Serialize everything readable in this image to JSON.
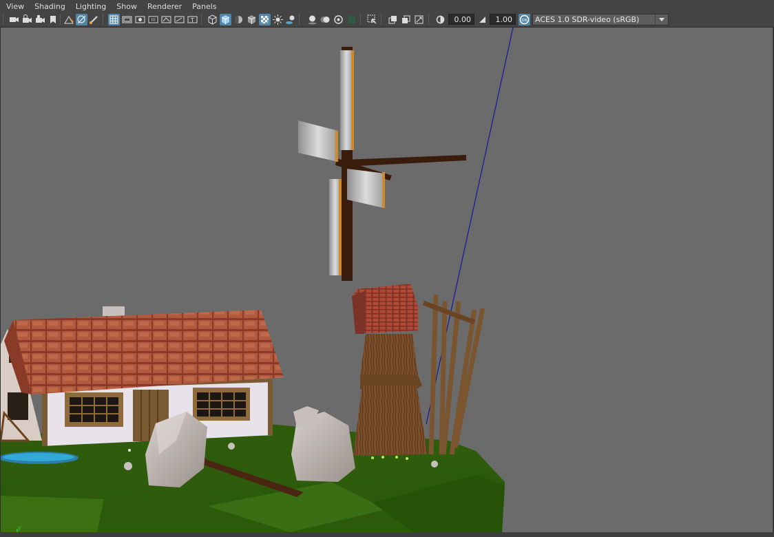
{
  "menubar": {
    "items": [
      "View",
      "Shading",
      "Lighting",
      "Show",
      "Renderer",
      "Panels"
    ]
  },
  "toolbar": {
    "exposure_value": "0.00",
    "gamma_value": "1.00",
    "color_space": "ACES 1.0 SDR-video (sRGB)",
    "icons": [
      "select-camera-icon",
      "camera-attributes-icon",
      "bookmarks-icon",
      "image-plane-icon",
      "two-d-pan-zoom-icon",
      "grease-pencil-icon",
      "grid-icon",
      "film-gate-icon",
      "resolution-gate-icon",
      "gate-mask-icon",
      "field-chart-icon",
      "safe-action-icon",
      "safe-title-icon",
      "wireframe-icon",
      "smooth-shade-icon",
      "default-lighting-icon",
      "wireframe-on-shaded-icon",
      "xray-icon",
      "use-all-lights-icon",
      "shadows-icon",
      "screen-space-ao-icon",
      "motion-blur-icon",
      "anti-aliasing-icon",
      "depth-of-field-icon",
      "isolate-select-icon",
      "xray-joints-icon",
      "xray-active-components-icon",
      "exposure-icon",
      "gamma-icon",
      "color-management-icon"
    ],
    "accent_color": "#5285a6"
  },
  "viewport": {
    "background_color": "#6b6b6b",
    "gizmo": {
      "x_label": "x",
      "y_label": "y",
      "z_label": "z"
    }
  }
}
